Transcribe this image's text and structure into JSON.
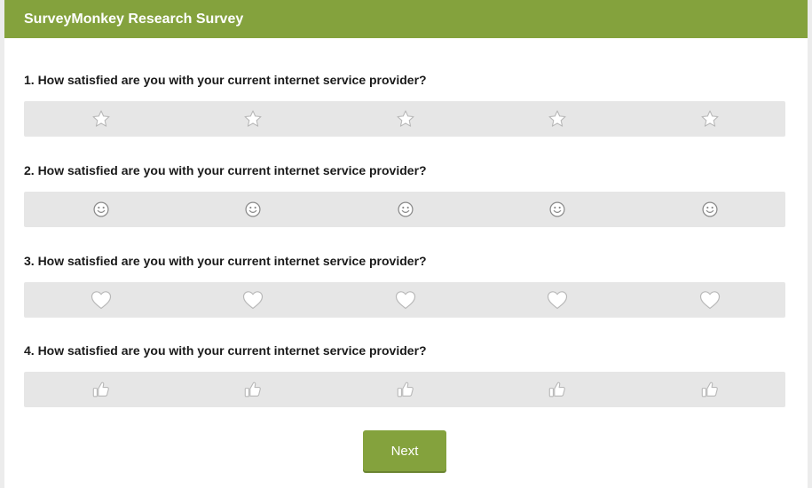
{
  "header": {
    "title": "SurveyMonkey Research Survey",
    "color": "#84a23d"
  },
  "questions": [
    {
      "label": "1. How satisfied are you with your current internet service provider?",
      "icon": "star-icon",
      "options": 5
    },
    {
      "label": "2. How satisfied are you with your current internet service provider?",
      "icon": "smiley-icon",
      "options": 5
    },
    {
      "label": "3. How satisfied are you with your current internet service provider?",
      "icon": "heart-icon",
      "options": 5
    },
    {
      "label": "4. How satisfied are you with your current internet service provider?",
      "icon": "thumbs-up-icon",
      "options": 5
    }
  ],
  "next_button": {
    "label": "Next"
  },
  "colors": {
    "accent": "#84a23d",
    "rating_bar": "#e6e6e6",
    "icon_stroke": "#b8b8b8"
  }
}
